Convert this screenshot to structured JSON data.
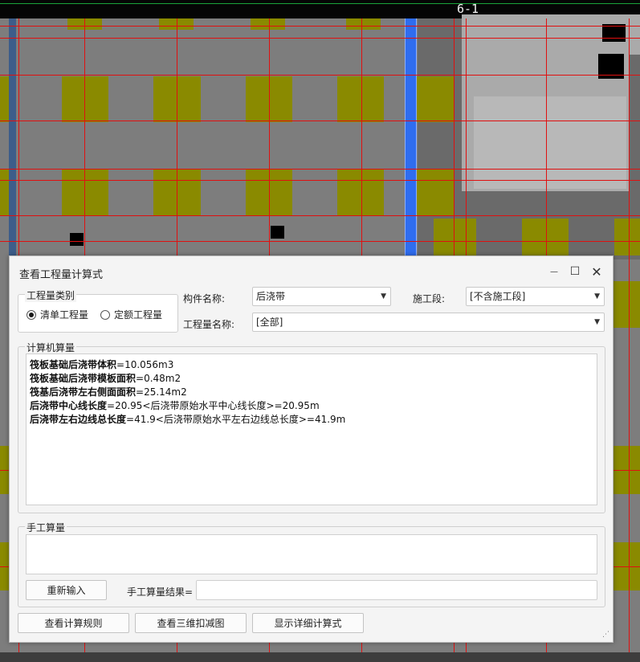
{
  "cad": {
    "axis_label": "6-1",
    "colors": {
      "background": "#7d7d7d",
      "column": "#8a8a00",
      "grid_line": "#e01010",
      "selected_strip": "#2f6df0"
    }
  },
  "dialog": {
    "title": "查看工程量计算式",
    "window_buttons": {
      "minimize": "—",
      "maximize": "☐",
      "close": "✕"
    },
    "quantity_type": {
      "legend": "工程量类别",
      "options": [
        {
          "label": "清单工程量",
          "checked": true
        },
        {
          "label": "定额工程量",
          "checked": false
        }
      ]
    },
    "component_name": {
      "label": "构件名称:",
      "value": "后浇带"
    },
    "construction_stage": {
      "label": "施工段:",
      "value": "[不含施工段]"
    },
    "quantity_name": {
      "label": "工程量名称:",
      "value": "[全部]"
    },
    "computer_calc": {
      "legend": "计算机算量",
      "lines": [
        {
          "bold": "筏板基础后浇带体积",
          "rest": "=10.056m3"
        },
        {
          "bold": "筏板基础后浇带模板面积",
          "rest": "=0.48m2"
        },
        {
          "bold": "筏基后浇带左右侧面面积",
          "rest": "=25.14m2"
        },
        {
          "bold": "后浇带中心线长度",
          "rest": "=20.95<后浇带原始水平中心线长度>=20.95m"
        },
        {
          "bold": "后浇带左右边线总长度",
          "rest": "=41.9<后浇带原始水平左右边线总长度>=41.9m"
        }
      ]
    },
    "manual_calc": {
      "legend": "手工算量",
      "reenter_button": "重新输入",
      "result_label": "手工算量结果=",
      "result_value": ""
    },
    "footer_buttons": {
      "view_rules": "查看计算规则",
      "view_3d": "查看三维扣减图",
      "show_detail": "显示详细计算式"
    }
  }
}
